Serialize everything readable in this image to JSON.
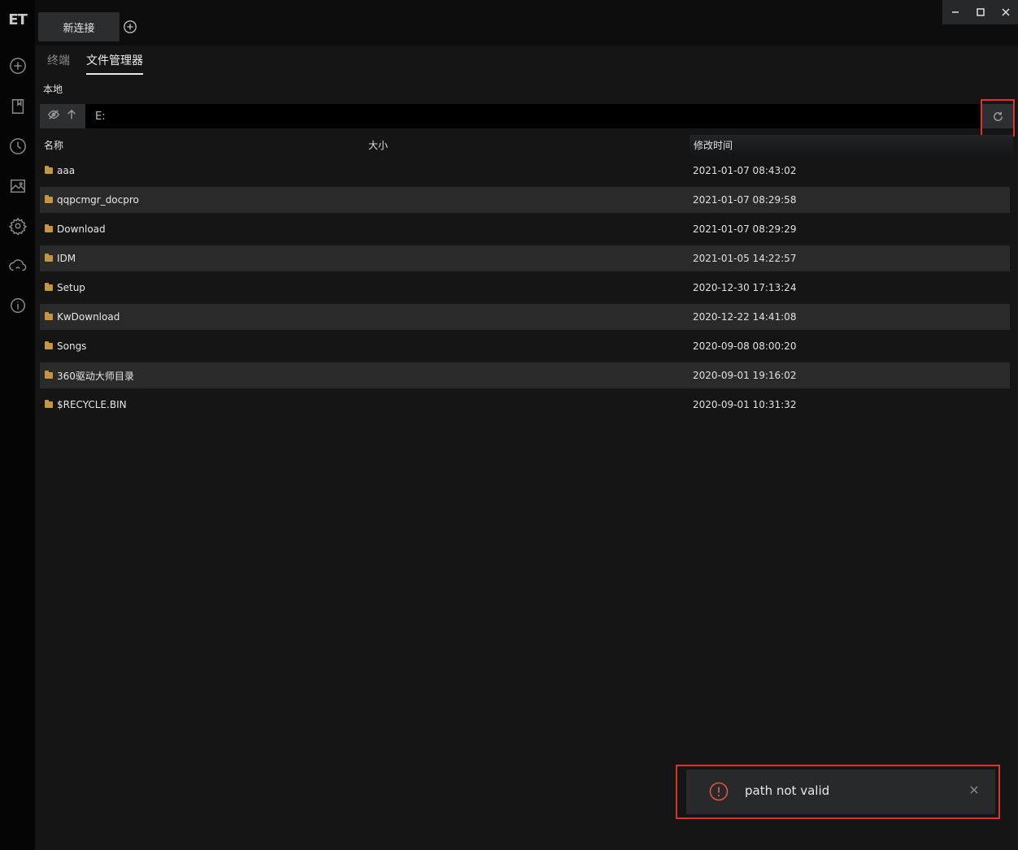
{
  "app": {
    "logo_text": "ET"
  },
  "sidebar": {
    "items": [
      {
        "icon": "add-circle-icon"
      },
      {
        "icon": "bookmark-icon"
      },
      {
        "icon": "clock-icon"
      },
      {
        "icon": "image-icon"
      },
      {
        "icon": "gear-icon"
      },
      {
        "icon": "cloud-sync-icon"
      },
      {
        "icon": "info-icon"
      }
    ]
  },
  "topbar": {
    "tab_label": "新连接",
    "status_color": "#1fd17a"
  },
  "subtabs": [
    {
      "label": "终端",
      "active": false
    },
    {
      "label": "文件管理器",
      "active": true
    }
  ],
  "local_label": "本地",
  "pathbar": {
    "path_value": "E:"
  },
  "table": {
    "headers": {
      "name": "名称",
      "size": "大小",
      "modified": "修改时间"
    },
    "rows": [
      {
        "name": "aaa",
        "size": "",
        "modified": "2021-01-07 08:43:02"
      },
      {
        "name": "qqpcmgr_docpro",
        "size": "",
        "modified": "2021-01-07 08:29:58"
      },
      {
        "name": "Download",
        "size": "",
        "modified": "2021-01-07 08:29:29"
      },
      {
        "name": "IDM",
        "size": "",
        "modified": "2021-01-05 14:22:57"
      },
      {
        "name": "Setup",
        "size": "",
        "modified": "2020-12-30 17:13:24"
      },
      {
        "name": "KwDownload",
        "size": "",
        "modified": "2020-12-22 14:41:08"
      },
      {
        "name": "Songs",
        "size": "",
        "modified": "2020-09-08 08:00:20"
      },
      {
        "name": "360驱动大师目录",
        "size": "",
        "modified": "2020-09-01 19:16:02"
      },
      {
        "name": "$RECYCLE.BIN",
        "size": "",
        "modified": "2020-09-01 10:31:32"
      }
    ]
  },
  "toast": {
    "message": "path not valid",
    "color": "#e0553f"
  },
  "colors": {
    "highlight": "#e03131",
    "folder": "#c7953e"
  }
}
